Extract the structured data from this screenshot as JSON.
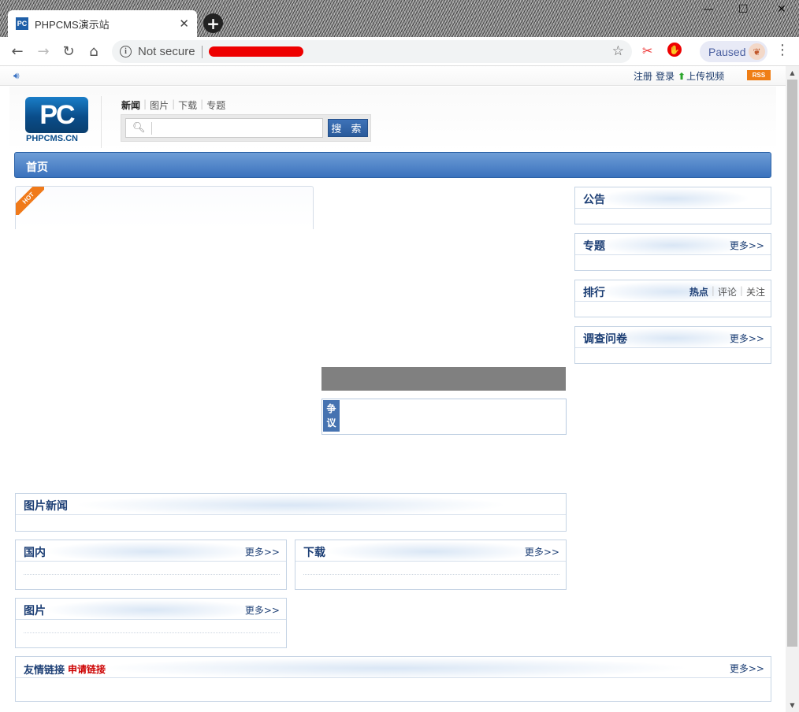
{
  "browser": {
    "tab_title": "PHPCMS演示站",
    "tab_favicon_text": "PC",
    "new_tab_symbol": "+",
    "security_label": "Not secure",
    "profile_label": "Paused",
    "window_controls": [
      "—",
      "☐",
      "✕"
    ]
  },
  "topbar": {
    "links": [
      "注册",
      "登录",
      "上传视频"
    ],
    "rss": "RSS"
  },
  "header": {
    "logo_text": "PC",
    "logo_subtext": "PHPCMS.CN",
    "search_tabs": [
      "新闻",
      "图片",
      "下载",
      "专题"
    ],
    "search_value": "",
    "search_button": "搜 索"
  },
  "nav": {
    "home": "首页"
  },
  "hot": {
    "badge": "HOT"
  },
  "dispute": {
    "tag": "争议"
  },
  "sidebar": {
    "notice": {
      "title": "公告"
    },
    "special": {
      "title": "专题",
      "more": "更多>>"
    },
    "ranking": {
      "title": "排行",
      "tabs": [
        "热点",
        "评论",
        "关注"
      ]
    },
    "survey": {
      "title": "调查问卷",
      "more": "更多>>"
    }
  },
  "sections": {
    "picture_news": {
      "title": "图片新闻"
    },
    "domestic": {
      "title": "国内",
      "more": "更多>>"
    },
    "download": {
      "title": "下载",
      "more": "更多>>"
    },
    "pictures": {
      "title": "图片",
      "more": "更多>>"
    },
    "links": {
      "title": "友情链接",
      "apply": "申请链接",
      "more": "更多>>"
    }
  }
}
